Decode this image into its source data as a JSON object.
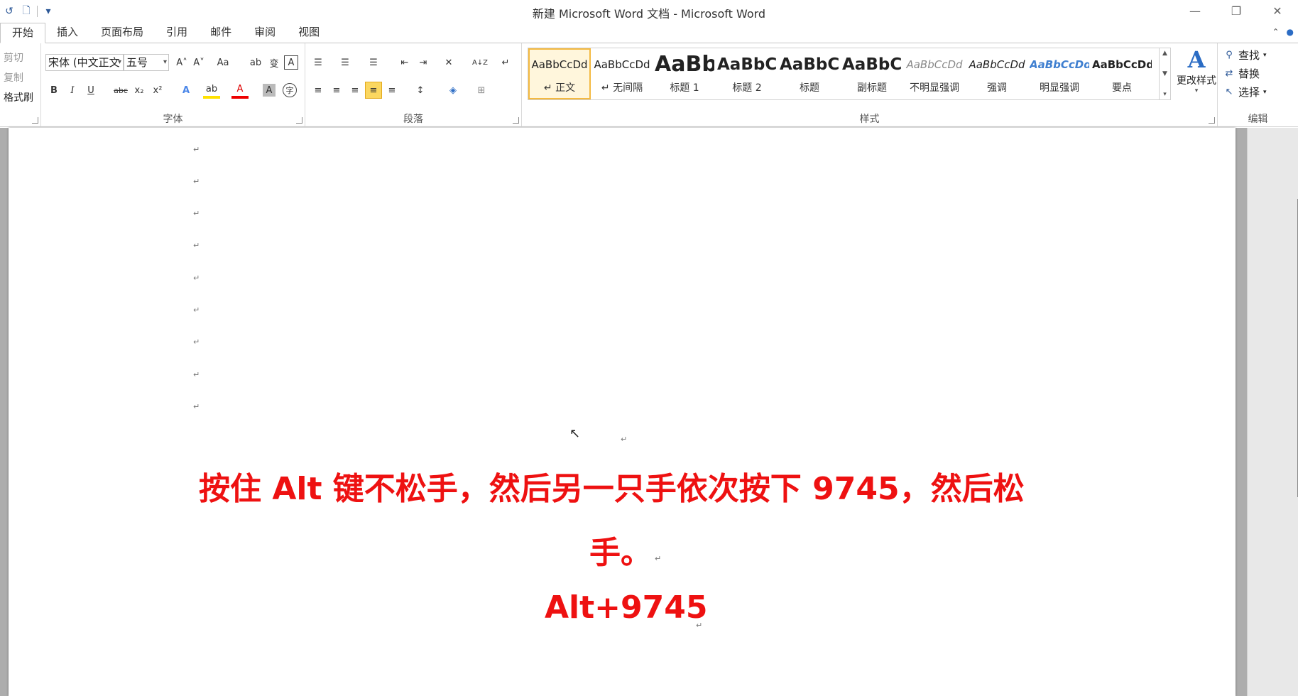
{
  "window": {
    "title": "新建 Microsoft Word 文档 - Microsoft Word",
    "controls": {
      "minimize": "—",
      "restore": "❐",
      "close": "✕"
    }
  },
  "qat": {
    "undo_icon": "↺",
    "new_icon": "🗋",
    "customize_icon": "▾"
  },
  "tabs": [
    {
      "label": "开始",
      "active": true
    },
    {
      "label": "插入"
    },
    {
      "label": "页面布局"
    },
    {
      "label": "引用"
    },
    {
      "label": "邮件"
    },
    {
      "label": "审阅"
    },
    {
      "label": "视图"
    }
  ],
  "ribbon": {
    "clipboard": {
      "cut": "剪切",
      "copy": "复制",
      "format_painter": "格式刷"
    },
    "font": {
      "label": "字体",
      "font_name": "宋体 (中文正文",
      "font_size": "五号",
      "grow": "A˄",
      "shrink": "A˅",
      "change_case": "Aa",
      "clear_format": "ab",
      "phonetic": "变",
      "char_border": "A",
      "bold": "B",
      "italic": "I",
      "underline": "U",
      "strike": "abc",
      "subscript": "x₂",
      "superscript": "x²",
      "text_effect": "A",
      "highlight": "ab",
      "font_color": "A",
      "char_shading": "A",
      "enclose": "字"
    },
    "paragraph": {
      "label": "段落",
      "bullets": "☰",
      "numbering": "☰",
      "multilevel": "☰",
      "dec_indent": "⇤",
      "inc_indent": "⇥",
      "cjk_layout": "✕",
      "sort": "A↓Z",
      "show_marks": "↵",
      "align_left": "≡",
      "align_center": "≡",
      "align_right": "≡",
      "justify": "≡",
      "distributed": "≡",
      "line_spacing": "↕",
      "shading": "◈",
      "borders": "⊞"
    },
    "styles": {
      "label": "样式",
      "items": [
        {
          "preview": "AaBbCcDd",
          "name": "↵ 正文",
          "selected": true
        },
        {
          "preview": "AaBbCcDd",
          "name": "↵ 无间隔"
        },
        {
          "preview": "AaBb",
          "name": "标题 1"
        },
        {
          "preview": "AaBbC",
          "name": "标题 2"
        },
        {
          "preview": "AaBbC",
          "name": "标题"
        },
        {
          "preview": "AaBbC",
          "name": "副标题"
        },
        {
          "preview": "AaBbCcDd",
          "name": "不明显强调"
        },
        {
          "preview": "AaBbCcDd",
          "name": "强调"
        },
        {
          "preview": "AaBbCcDd",
          "name": "明显强调"
        },
        {
          "preview": "AaBbCcDd",
          "name": "要点"
        }
      ],
      "change_styles": "更改样式",
      "change_styles_icon": "A"
    },
    "editing": {
      "label": "编辑",
      "find": "查找",
      "replace": "替换",
      "select": "选择"
    }
  },
  "document": {
    "para_mark": "↵",
    "line1": "按住 Alt 键不松手，然后另一只手依次按下 9745，然后松",
    "line2": "手。",
    "line3": "Alt+9745"
  },
  "colors": {
    "accent_red": "#ee1111",
    "selected_style": "#f4b940"
  }
}
